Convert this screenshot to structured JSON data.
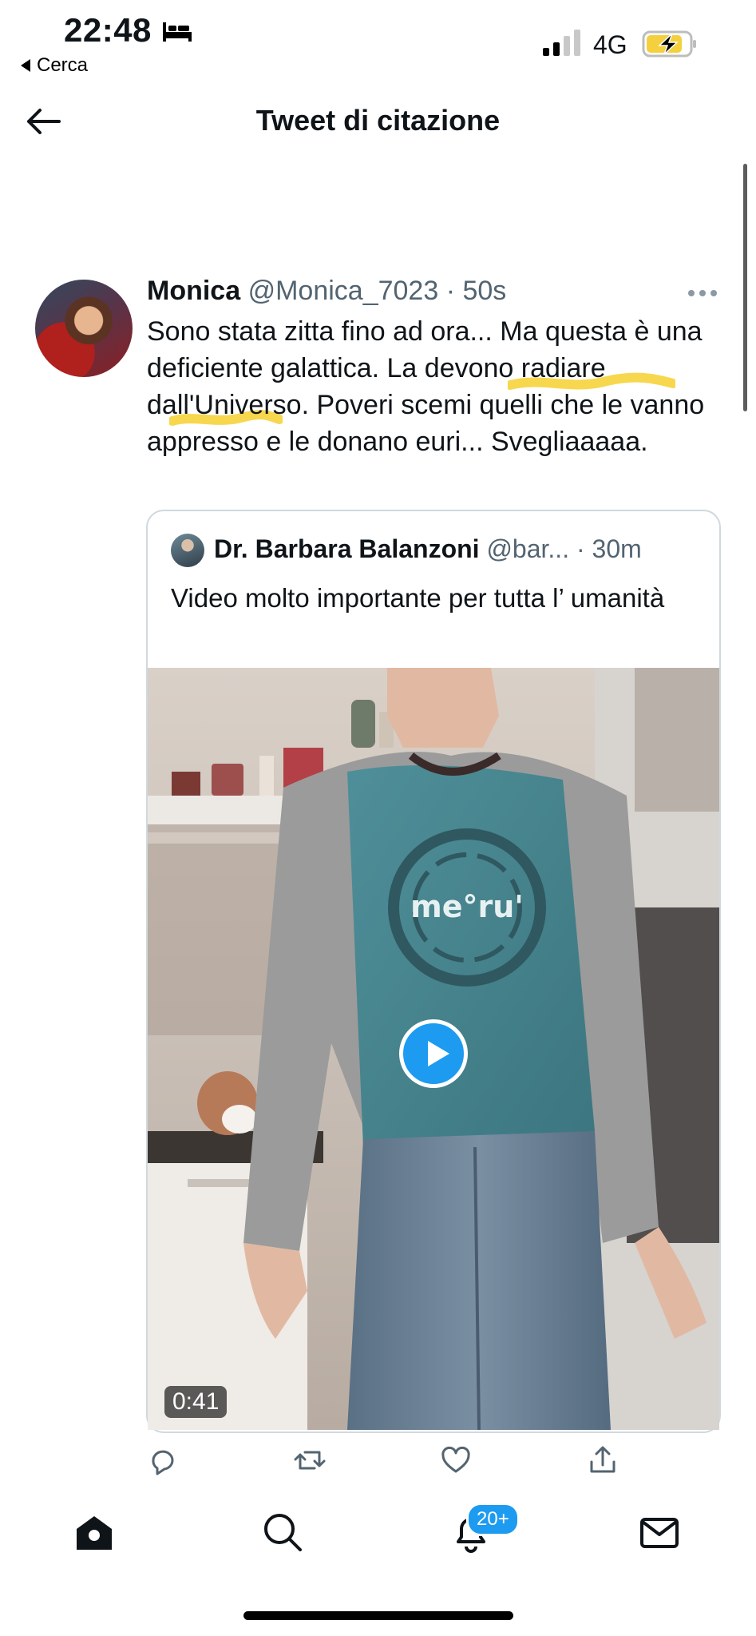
{
  "status_bar": {
    "time": "22:48",
    "back_app": "Cerca",
    "network": "4G",
    "icons": [
      "bed-icon",
      "signal-icon",
      "battery-charging-icon"
    ]
  },
  "header": {
    "title": "Tweet di citazione"
  },
  "tweet": {
    "author_name": "Monica",
    "handle": "@Monica_7023",
    "separator": "·",
    "time": "50s",
    "text": "Sono stata zitta fino ad ora... Ma questa è una deficiente galattica. La devono radiare dall'Universo. Poveri scemi quelli che le vanno appresso e le donano euri... Svegliaaaaa.",
    "highlight_color": "#f6d33b"
  },
  "quoted_tweet": {
    "author_name": "Dr. Barbara Balanzoni",
    "handle": "@bar...",
    "separator": "·",
    "time": "30m",
    "text": "Video molto importante per tutta l’ umanità",
    "video_duration": "0:41",
    "shirt_logo": "me°ru'"
  },
  "actions": [
    "reply-icon",
    "retweet-icon",
    "like-icon",
    "share-icon"
  ],
  "bottom_nav": {
    "items": [
      "home-icon",
      "search-icon",
      "notifications-icon",
      "messages-icon"
    ],
    "notifications_badge": "20+"
  },
  "colors": {
    "accent": "#1d9bf0",
    "secondary_text": "#536471",
    "border": "#cfd9de"
  }
}
